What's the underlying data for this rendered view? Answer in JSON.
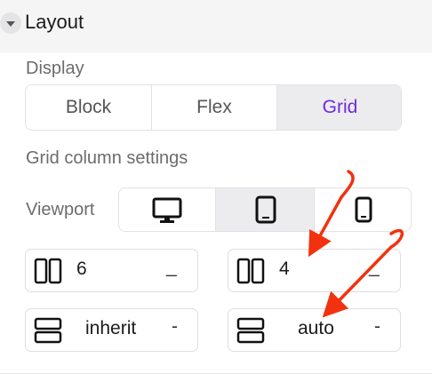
{
  "section": {
    "title": "Layout",
    "caret_icon": "caret-down-icon"
  },
  "display": {
    "label": "Display",
    "options": [
      "Block",
      "Flex",
      "Grid"
    ],
    "selected": "Grid",
    "accent_color": "#6f2bd9"
  },
  "grid_settings": {
    "label": "Grid column settings"
  },
  "viewport": {
    "label": "Viewport",
    "options": [
      "desktop-icon",
      "tablet-icon",
      "mobile-icon"
    ],
    "selected": "tablet-icon"
  },
  "fields": {
    "columns_desktop": {
      "value": "6",
      "suffix": "_",
      "icon": "columns-icon"
    },
    "columns_tablet": {
      "value": "4",
      "suffix": "_",
      "icon": "columns-icon"
    },
    "rows_desktop": {
      "value": "inherit",
      "suffix": "-",
      "icon": "rows-icon"
    },
    "rows_tablet": {
      "value": "auto",
      "suffix": "-",
      "icon": "rows-icon"
    }
  },
  "annotations": {
    "arrow_color": "#f2320f"
  }
}
